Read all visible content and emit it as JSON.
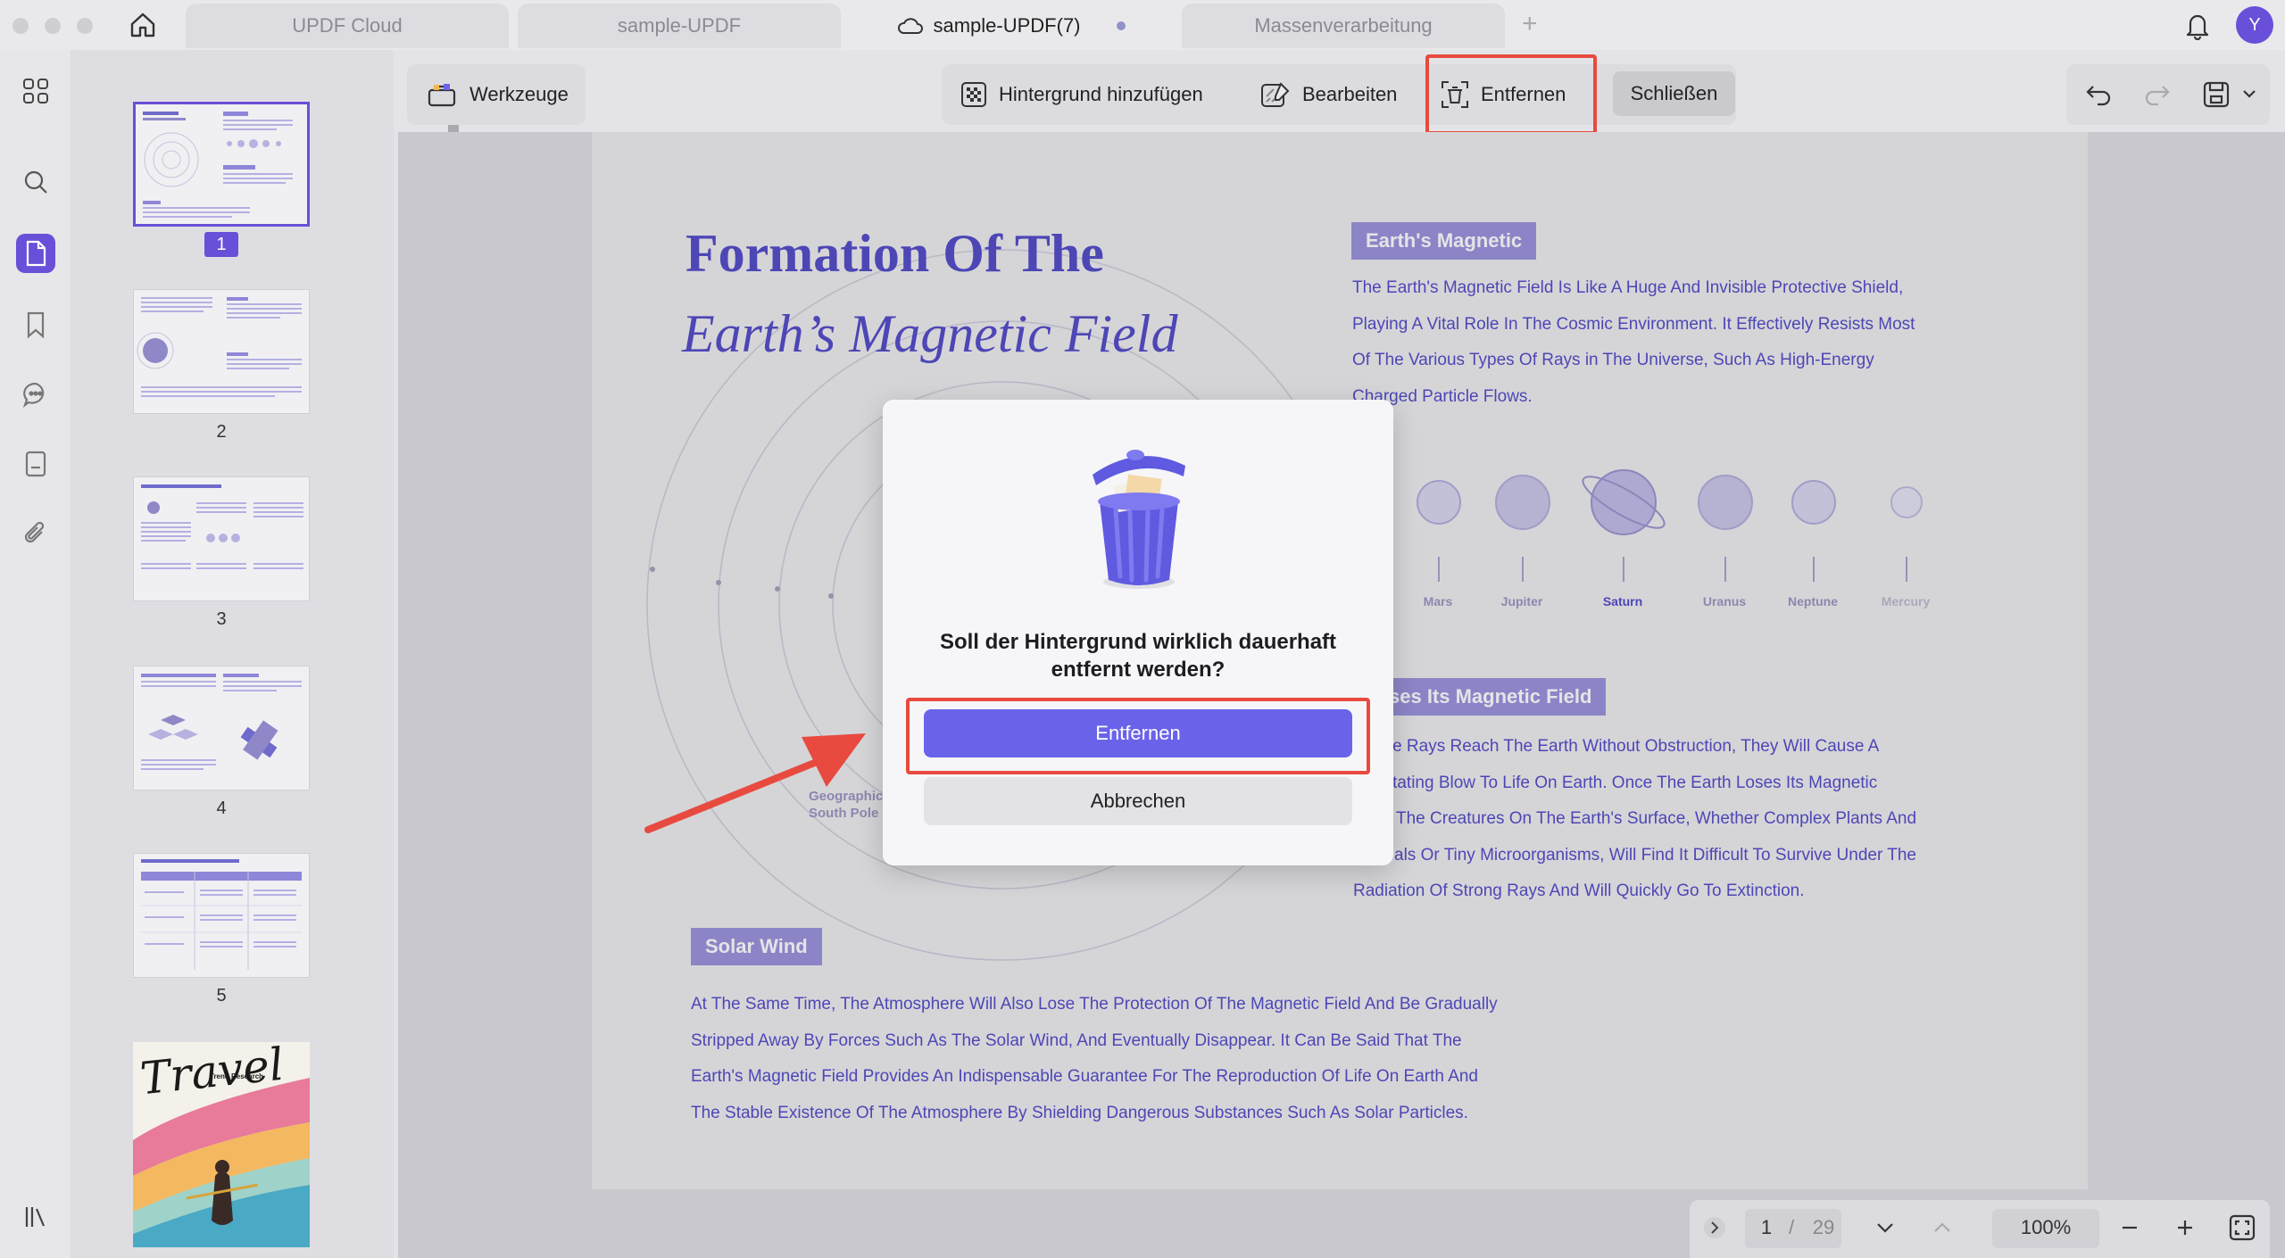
{
  "tabs": [
    {
      "label": "UPDF Cloud"
    },
    {
      "label": "sample-UPDF"
    },
    {
      "label": "sample-UPDF(7)"
    },
    {
      "label": "Massenverarbeitung"
    }
  ],
  "user": {
    "initial": "Y"
  },
  "toolbar": {
    "tools_label": "Werkzeuge",
    "add_background_label": "Hintergrund hinzufügen",
    "edit_label": "Bearbeiten",
    "remove_label": "Entfernen",
    "close_label": "Schließen"
  },
  "thumbnails": [
    {
      "number": "1"
    },
    {
      "number": "2"
    },
    {
      "number": "3"
    },
    {
      "number": "4"
    },
    {
      "number": "5"
    }
  ],
  "thumb_cover": {
    "script_word": "Travel",
    "tag": "Trend Research"
  },
  "document": {
    "title_line1": "Formation Of The",
    "title_line2": "Earth’s Magnetic Field",
    "section1_heading": "Earth's Magnetic",
    "section1_lines": [
      "The Earth's Magnetic Field Is Like A Huge And Invisible Protective Shield,",
      "Playing A Vital Role In The Cosmic Environment. It Effectively Resists Most",
      "Of The Various Types Of Rays in The Universe, Such As High-Energy",
      "Charged Particle Flows."
    ],
    "planets": [
      "Mars",
      "Jupiter",
      "Saturn",
      "Uranus",
      "Neptune",
      "Mercury"
    ],
    "section2_heading": "ses Its Magnetic Field",
    "section2_lines": [
      "ese Rays Reach The Earth Without Obstruction, They Will Cause A",
      "astating Blow To Life On Earth. Once The Earth Loses Its Magnetic",
      "The Creatures On The Earth's Surface, Whether Complex Plants And",
      "als Or Tiny Microorganisms, Will Find It Difficult To Survive Under The",
      "Radiation Of Strong Rays And Will Quickly Go To Extinction."
    ],
    "pole_label_line1": "Geographic",
    "pole_label_line2": "South Pole",
    "section3_heading": "Solar Wind",
    "section3_lines": [
      "At The Same Time, The Atmosphere Will Also Lose The Protection Of The Magnetic Field And Be Gradually",
      "Stripped Away By Forces Such As The Solar Wind, And Eventually Disappear. It Can Be Said That The",
      "Earth's Magnetic Field Provides An Indispensable Guarantee For The Reproduction Of Life On Earth And",
      "The Stable Existence Of The Atmosphere By Shielding Dangerous Substances Such As Solar Particles."
    ]
  },
  "dialog": {
    "message": "Soll der Hintergrund wirklich dauerhaft entfernt werden?",
    "confirm_label": "Entfernen",
    "cancel_label": "Abbrechen"
  },
  "pagination": {
    "current": "1",
    "separator": "/",
    "total": "29",
    "zoom": "100%"
  },
  "colors": {
    "accent": "#6a4fd8",
    "highlight": "#e84a3f",
    "doc_text": "#3e35c0"
  }
}
